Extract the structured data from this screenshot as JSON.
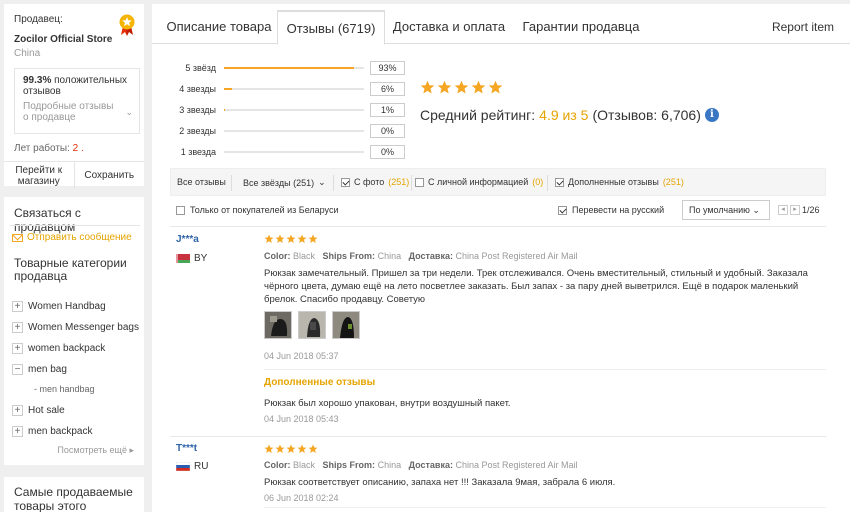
{
  "seller": {
    "label": "Продавец:",
    "name": "Zocilor Official Store",
    "country": "China",
    "positive_pct": "99.3%",
    "positive_text": "положительных отзывов",
    "detail_link": "Подробные отзывы о продавце",
    "years_label": "Лет работы:",
    "years_value": "2 .",
    "go_store": "Перейти к магазину",
    "save": "Сохранить"
  },
  "contact": {
    "title": "Связаться с продавцом",
    "send_message": "Отправить сообщение"
  },
  "categories": {
    "title": "Товарные категории продавца",
    "items": [
      {
        "label": "Women Handbag",
        "icon": "+"
      },
      {
        "label": "Women Messenger bags",
        "icon": "+"
      },
      {
        "label": "women backpack",
        "icon": "+"
      },
      {
        "label": "men bag",
        "icon": "−"
      },
      {
        "label": "Hot sale",
        "icon": "+"
      },
      {
        "label": "men backpack",
        "icon": "+"
      }
    ],
    "subitem": "- men handbag",
    "more": "Посмотреть ещё"
  },
  "bestsellers": {
    "title": "Самые продаваемые товары этого продавца"
  },
  "tabs": [
    {
      "label": "Описание товара"
    },
    {
      "label": "Отзывы (6719)"
    },
    {
      "label": "Доставка и оплата"
    },
    {
      "label": "Гарантии продавца"
    }
  ],
  "report_item": "Report item",
  "rating_dist": [
    {
      "label": "5 звёзд",
      "pct": "93%",
      "fill": 0.93
    },
    {
      "label": "4 звезды",
      "pct": "6%",
      "fill": 0.06
    },
    {
      "label": "3 звезды",
      "pct": "1%",
      "fill": 0.01
    },
    {
      "label": "2 звезды",
      "pct": "0%",
      "fill": 0
    },
    {
      "label": "1 звезда",
      "pct": "0%",
      "fill": 0
    }
  ],
  "average": {
    "label": "Средний рейтинг:",
    "rate": "4.9 из 5",
    "count": "(Отзывов: 6,706)",
    "info_icon": "i"
  },
  "filters": {
    "all_reviews": "Все отзывы",
    "all_stars": "Все звёзды (251)",
    "with_photo": "С фото",
    "with_photo_count": "(251)",
    "with_personal": "С личной информацией",
    "with_personal_count": "(0)",
    "additional": "Дополненные отзывы",
    "additional_count": "(251)",
    "only_buyers": "Только от покупателей из Беларуси",
    "translate": "Перевести на русский",
    "sort": "По умолчанию",
    "page": "1/26"
  },
  "reviews": [
    {
      "user": "J***a",
      "country": "BY",
      "color_label": "Color:",
      "color": "Black",
      "ships_label": "Ships From:",
      "ships": "China",
      "delivery_label": "Доставка:",
      "delivery": "China Post Registered Air Mail",
      "text": "Рюкзак замечательный. Пришел за три недели. Трек отслеживался. Очень вместительный, стильный и удобный. Заказала чёрного цвета, думаю ещё на лето посветлее заказать. Был запах - за пару дней выветрился. Ещё в подарок маленький брелок. Спасибо продавцу. Советую",
      "date": "04 Jun 2018 05:37",
      "additional_title": "Дополненные отзывы",
      "additional_text": "Рюкзак был хорошо упакован, внутри воздушный пакет.",
      "additional_date": "04 Jun 2018 05:43"
    },
    {
      "user": "T***t",
      "country": "RU",
      "color_label": "Color:",
      "color": "Black",
      "ships_label": "Ships From:",
      "ships": "China",
      "delivery_label": "Доставка:",
      "delivery": "China Post Registered Air Mail",
      "text": "Рюкзак соответствует описанию, запаха нет !!! Заказала 9мая, забрала 6 июля.",
      "date": "06 Jun 2018 02:24"
    }
  ],
  "colors": {
    "star": "#f5a623",
    "accent": "#e5a400",
    "link": "#2f64a8",
    "info": "#3977c4"
  }
}
